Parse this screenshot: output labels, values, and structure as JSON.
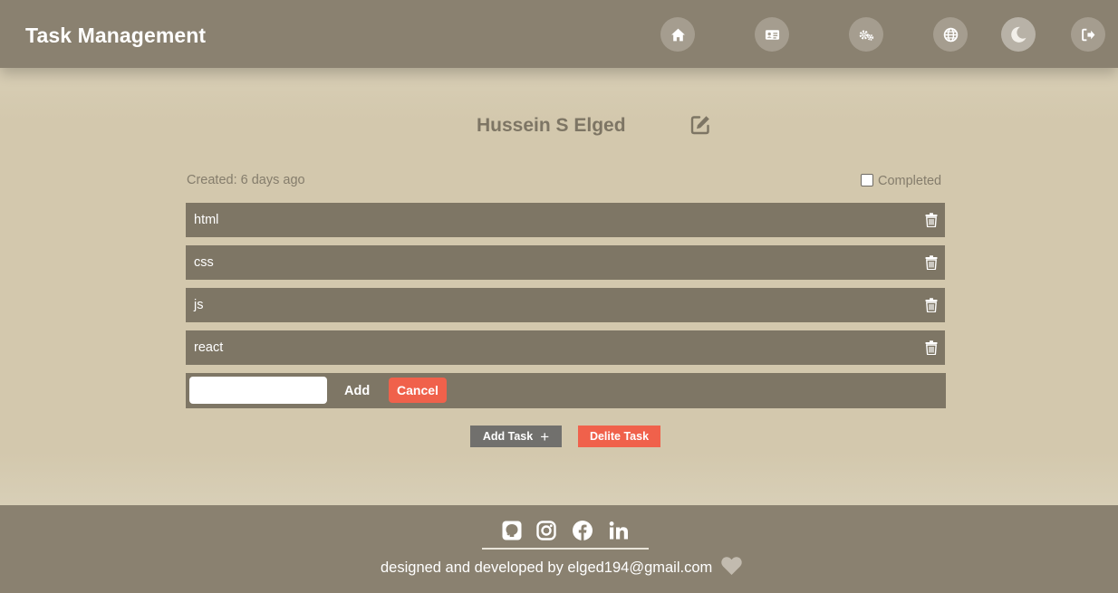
{
  "header": {
    "title": "Task Management",
    "nav_icons": [
      "home-icon",
      "id-card-icon",
      "cogs-icon",
      "globe-icon",
      "moon-icon",
      "sign-out-icon"
    ]
  },
  "task": {
    "user_name": "Hussein S Elged",
    "created": "Created: 6 days ago",
    "completed_label": "Completed",
    "completed_checked": false,
    "items": [
      "html",
      "css",
      "js",
      "react"
    ],
    "input_value": "",
    "add_label": "Add",
    "cancel_label": "Cancel",
    "add_task_label": "Add Task",
    "add_task_icon": "+",
    "delete_task_label": "Delite Task"
  },
  "footer": {
    "social_icons": [
      "github-icon",
      "instagram-icon",
      "facebook-icon",
      "linkedin-icon"
    ],
    "credit": "designed and developed by elged194@gmail.com"
  },
  "colors": {
    "header_bg": "#8a8170",
    "page_bg": "#d3c8ad",
    "row_bg": "#7e7665",
    "accent_red": "#f0614b",
    "button_gray": "#71706d"
  }
}
